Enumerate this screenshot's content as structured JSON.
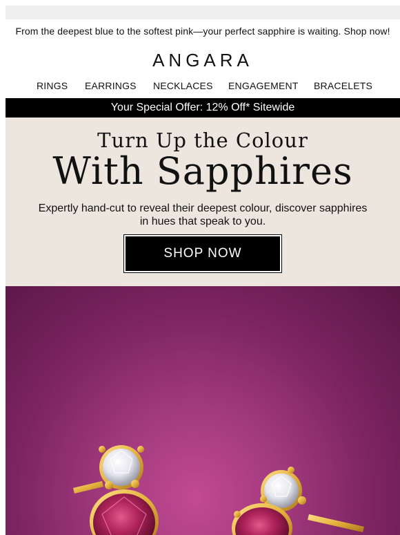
{
  "preheader": "From the deepest blue to the softest pink—your perfect sapphire is waiting. Shop now!",
  "brand": {
    "logo_text": "ANGARA"
  },
  "nav": {
    "items": [
      "RINGS",
      "EARRINGS",
      "NECKLACES",
      "ENGAGEMENT",
      "BRACELETS"
    ]
  },
  "offer": {
    "text": "Your Special Offer: 12% Off* Sitewide"
  },
  "hero": {
    "subtitle": "Turn Up the Colour",
    "title": "With Sapphires",
    "description": "Expertly hand-cut to reveal their deepest colour, discover sapphires in hues that speak to you.",
    "cta_label": "SHOP NOW"
  },
  "colors": {
    "offer_bar": "#000000",
    "hero_background": "#ede6df",
    "cta_background": "#000000",
    "product_background": "#8a2a6c",
    "gold": "#e3b23c",
    "pink_sapphire": "#b0245c"
  },
  "product_image": {
    "icon": "pink-sapphire-diamond-stud-earrings-photo"
  }
}
